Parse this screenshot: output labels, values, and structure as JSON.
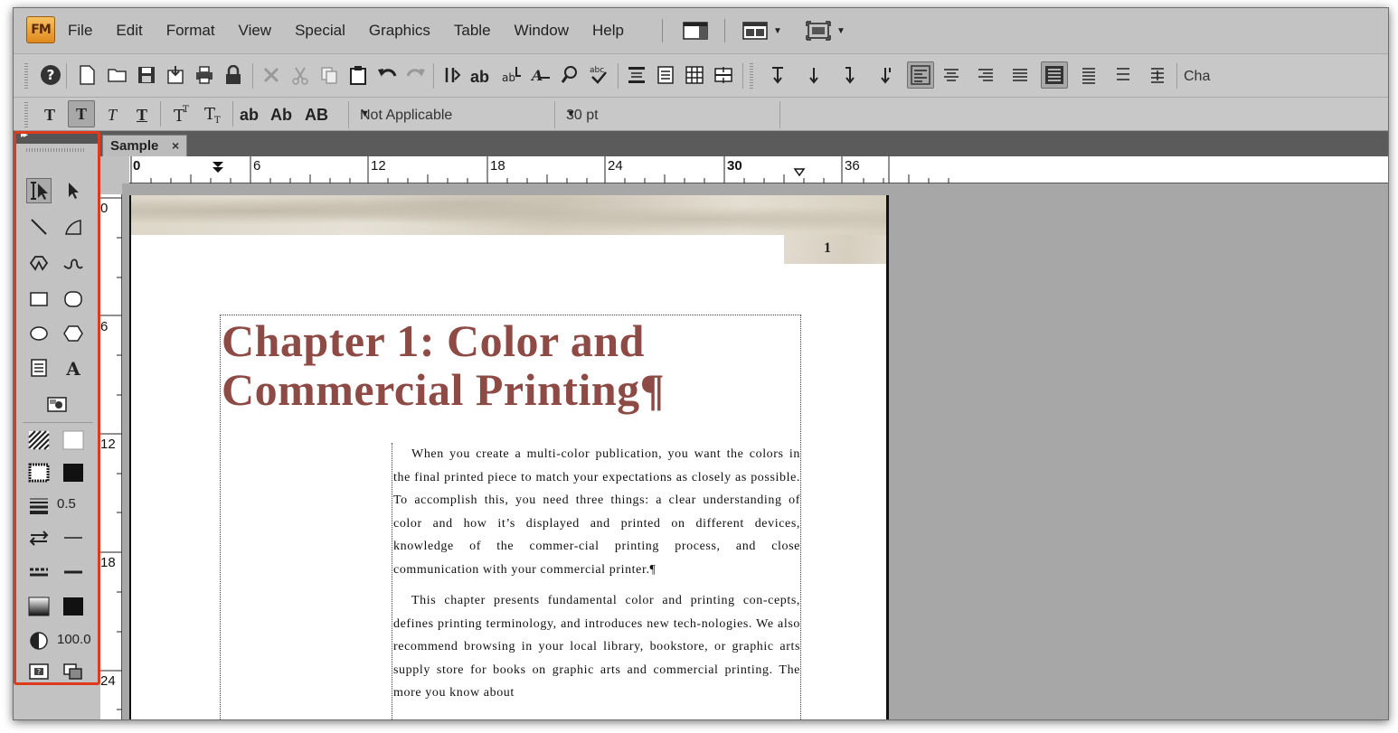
{
  "app": {
    "logo_text": "FM",
    "menu": [
      "File",
      "Edit",
      "Format",
      "View",
      "Special",
      "Graphics",
      "Table",
      "Window",
      "Help"
    ]
  },
  "toolbar1": {
    "trailing_label": "Cha"
  },
  "toolbar2": {
    "style_buttons": [
      "T",
      "T",
      "T",
      "T"
    ],
    "case_buttons": [
      "ab",
      "Ab",
      "AB"
    ],
    "font_family": "Not Applicable",
    "font_size": "30 pt"
  },
  "palette": {
    "line_width": "0.5",
    "tint": "100.0"
  },
  "document": {
    "tab_title": "Sample",
    "tab_close": "×",
    "page_number": "1",
    "chapter_title_line1": "Chapter 1: Color and",
    "chapter_title_line2": "Commercial Printing¶",
    "paragraph1": "When you create a multi-color publication, you want the colors in the final printed piece to match your expectations as closely as possible. To accomplish this, you need three things: a clear understanding of color and how it’s displayed and printed on different devices, knowledge of the commer-cial printing process, and close communication with your commercial printer.¶",
    "paragraph2": "This chapter presents fundamental color and printing con-cepts, defines printing terminology, and introduces new tech-nologies. We also recommend browsing in your local library, bookstore, or graphic arts supply store for books on graphic arts and commercial printing. The more you know about"
  },
  "rulers": {
    "horizontal": [
      "0",
      "6",
      "12",
      "18",
      "24",
      "30",
      "36"
    ],
    "vertical": [
      "0",
      "6",
      "12",
      "18",
      "24"
    ]
  },
  "colors": {
    "title": "#8e4a44",
    "highlight": "#e03a1c",
    "tabbar": "#5b5b5b"
  }
}
